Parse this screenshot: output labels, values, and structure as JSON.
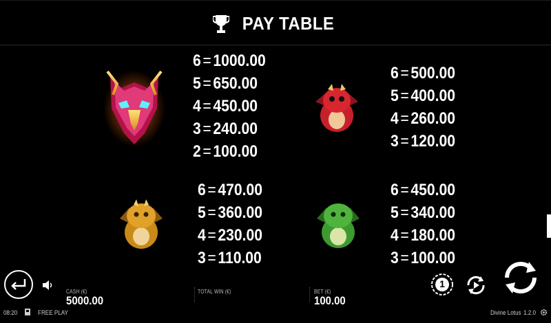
{
  "header": {
    "title": "PAY TABLE"
  },
  "paytable": [
    {
      "symbol": "phoenix-mask-icon",
      "payouts": [
        {
          "count": "6",
          "value": "1000.00"
        },
        {
          "count": "5",
          "value": "650.00"
        },
        {
          "count": "4",
          "value": "450.00"
        },
        {
          "count": "3",
          "value": "240.00"
        },
        {
          "count": "2",
          "value": "100.00"
        }
      ]
    },
    {
      "symbol": "red-dragon-icon",
      "payouts": [
        {
          "count": "6",
          "value": "500.00"
        },
        {
          "count": "5",
          "value": "400.00"
        },
        {
          "count": "4",
          "value": "260.00"
        },
        {
          "count": "3",
          "value": "120.00"
        }
      ]
    },
    {
      "symbol": "gold-dragon-icon",
      "payouts": [
        {
          "count": "6",
          "value": "470.00"
        },
        {
          "count": "5",
          "value": "360.00"
        },
        {
          "count": "4",
          "value": "230.00"
        },
        {
          "count": "3",
          "value": "110.00"
        }
      ]
    },
    {
      "symbol": "green-dragon-icon",
      "payouts": [
        {
          "count": "6",
          "value": "450.00"
        },
        {
          "count": "5",
          "value": "340.00"
        },
        {
          "count": "4",
          "value": "180.00"
        },
        {
          "count": "3",
          "value": "100.00"
        }
      ]
    }
  ],
  "footer": {
    "cash_label": "CASH (€)",
    "cash_value": "5000.00",
    "total_win_label": "TOTAL WIN (€)",
    "total_win_value": "",
    "bet_label": "BET (€)",
    "bet_value": "100.00",
    "time": "08:20",
    "mode": "FREE PLAY",
    "game_name": "Divine Lotus",
    "version": "1.2.0",
    "coin_value": "1"
  },
  "icons": {
    "back": "back-arrow-icon",
    "sound": "speaker-icon",
    "coin": "coin-value-icon",
    "autoplay": "autoplay-icon",
    "spin": "spin-icon",
    "settings": "gear-icon",
    "trophy": "trophy-icon",
    "wallet": "wallet-icon"
  }
}
